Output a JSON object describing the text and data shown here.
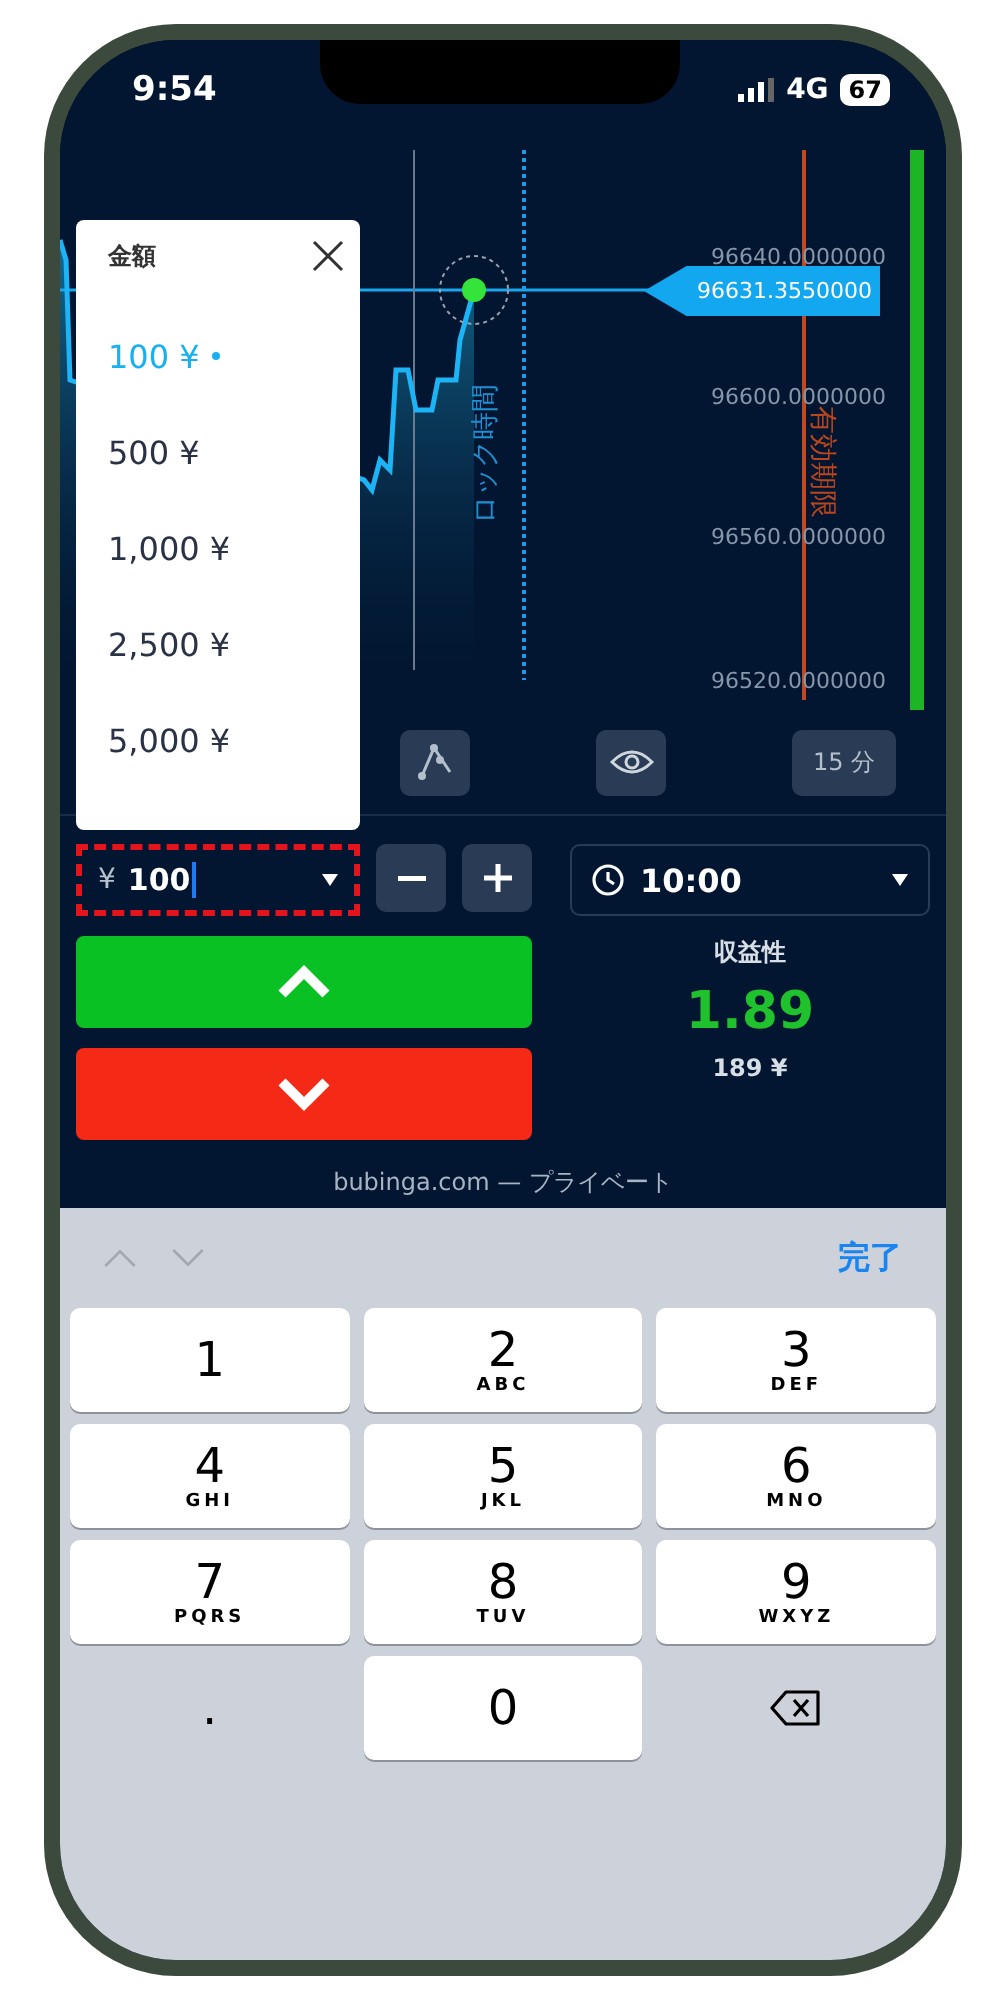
{
  "status_bar": {
    "time": "9:54",
    "network": "4G",
    "battery": "67"
  },
  "chart": {
    "price_ticks": [
      "96640.0000000",
      "96600.0000000",
      "96560.0000000",
      "96520.0000000"
    ],
    "current_price": "96631.3550000",
    "lock_label": "ロック時間",
    "expiry_label": "有効期限"
  },
  "timeframe": "15 分",
  "amount_menu": {
    "title": "金額",
    "options": [
      {
        "label": "100 ¥",
        "selected": true
      },
      {
        "label": "500 ¥",
        "selected": false
      },
      {
        "label": "1,000 ¥",
        "selected": false
      },
      {
        "label": "2,500 ¥",
        "selected": false
      },
      {
        "label": "5,000 ¥",
        "selected": false
      }
    ]
  },
  "amount_field": {
    "currency": "¥",
    "value": "100"
  },
  "time_field": {
    "value": "10:00"
  },
  "payout": {
    "label": "収益性",
    "rate": "1.89",
    "amount": "189 ¥"
  },
  "footer": "bubinga.com — プライベート",
  "keyboard": {
    "done": "完了",
    "keys": [
      {
        "kind": "digit",
        "digit": "1"
      },
      {
        "kind": "digit",
        "digit": "2",
        "letters": "ABC"
      },
      {
        "kind": "digit",
        "digit": "3",
        "letters": "DEF"
      },
      {
        "kind": "digit",
        "digit": "4",
        "letters": "GHI"
      },
      {
        "kind": "digit",
        "digit": "5",
        "letters": "JKL"
      },
      {
        "kind": "digit",
        "digit": "6",
        "letters": "MNO"
      },
      {
        "kind": "digit",
        "digit": "7",
        "letters": "PQRS"
      },
      {
        "kind": "digit",
        "digit": "8",
        "letters": "TUV"
      },
      {
        "kind": "digit",
        "digit": "9",
        "letters": "WXYZ"
      },
      {
        "kind": "dot",
        "digit": "."
      },
      {
        "kind": "digit",
        "digit": "0"
      },
      {
        "kind": "delete"
      }
    ]
  }
}
